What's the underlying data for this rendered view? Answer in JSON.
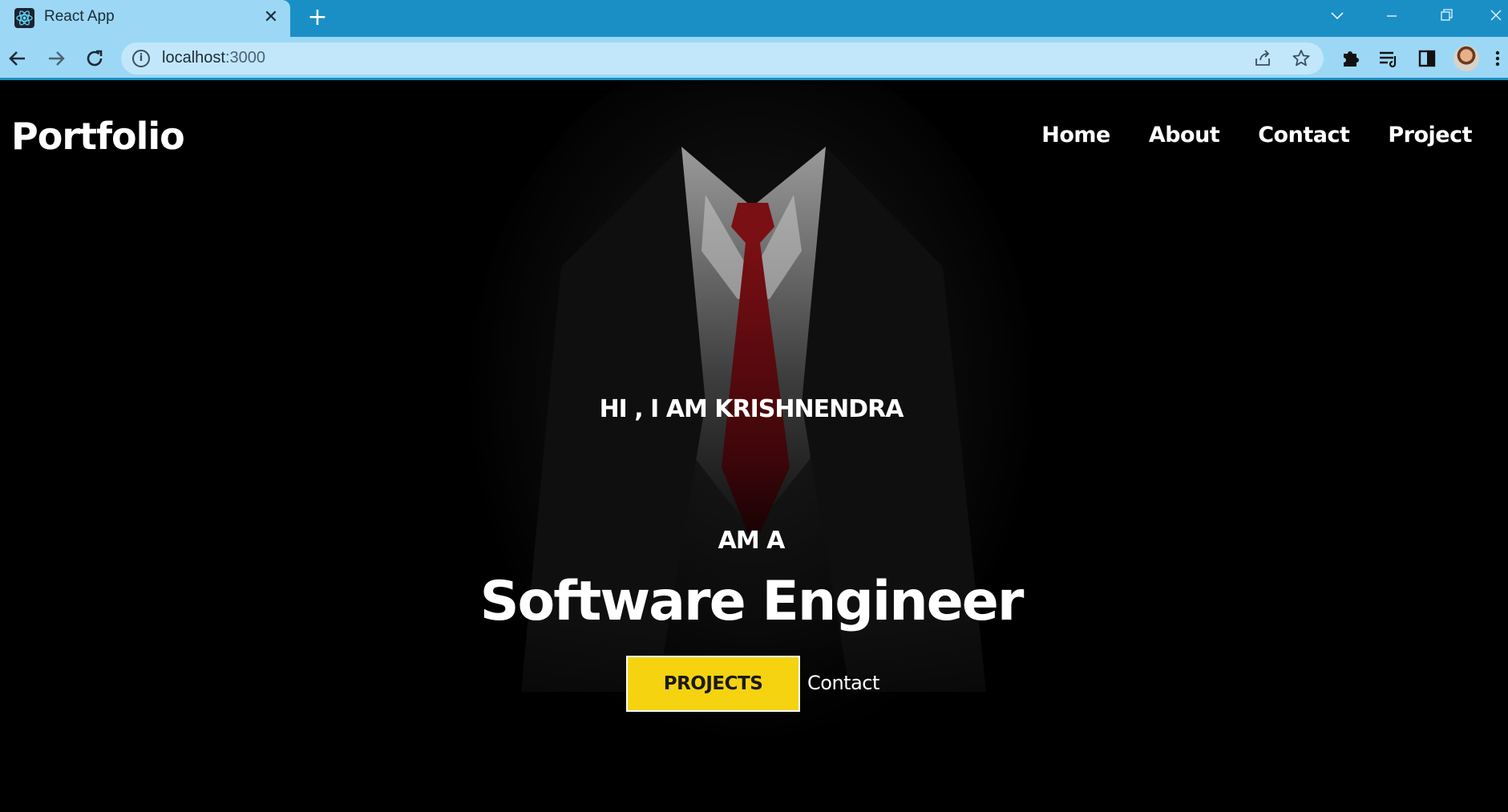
{
  "browser": {
    "tab_title": "React App",
    "tab_close": "✕",
    "new_tab": "+",
    "url_host": "localhost",
    "url_port": ":3000",
    "icons": [
      "react-favicon",
      "back-arrow-icon",
      "forward-arrow-icon",
      "reload-icon",
      "info-icon",
      "share-icon",
      "star-icon",
      "extensions-icon",
      "reading-list-icon",
      "side-panel-icon",
      "avatar",
      "menu-icon",
      "tab-search-icon",
      "minimize-icon",
      "restore-icon",
      "close-window-icon"
    ]
  },
  "site": {
    "brand": "Portfolio",
    "nav": [
      "Home",
      "About",
      "Contact",
      "Project"
    ]
  },
  "hero": {
    "greeting": "HI , I AM KRISHNENDRA",
    "intro": "AM A",
    "role": "Software Engineer",
    "primary_button": "PROJECTS",
    "secondary_link": "Contact"
  },
  "colors": {
    "tabbar": "#1a8fc6",
    "toolbar": "#9cd8f5",
    "page_bg": "#000000",
    "accent_yellow": "#f5d311",
    "tie_red": "#7a0f14"
  }
}
